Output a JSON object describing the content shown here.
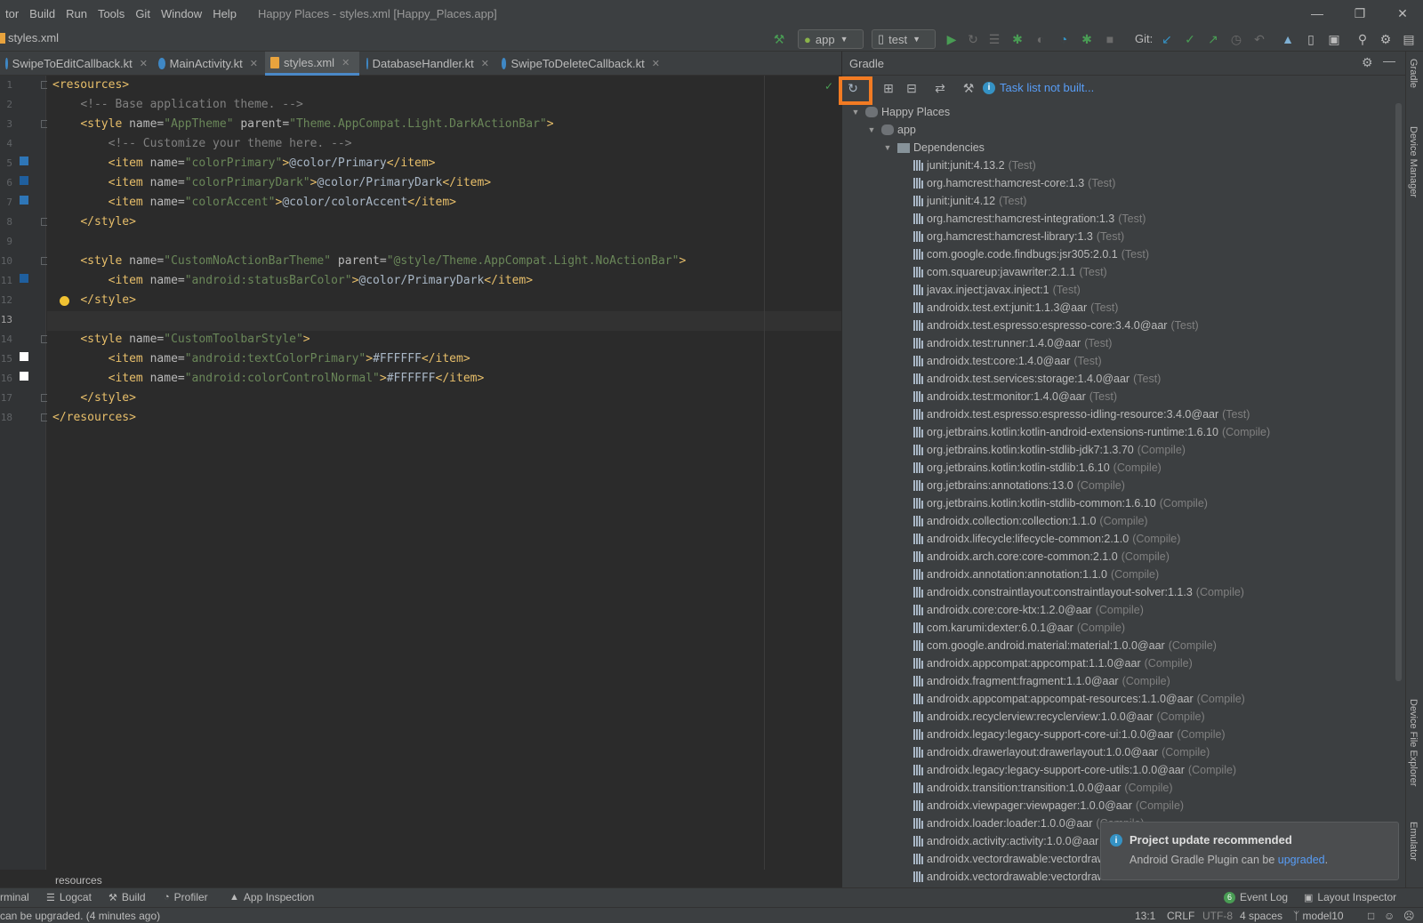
{
  "menubar": {
    "items": [
      "tor",
      "Build",
      "Run",
      "Tools",
      "Git",
      "Window",
      "Help"
    ],
    "window_title": "Happy Places - styles.xml [Happy_Places.app]"
  },
  "navbar": {
    "file": "styles.xml",
    "run_config": "app",
    "device": "test",
    "git_label": "Git:"
  },
  "tabs": [
    {
      "label": "SwipeToEditCallback.kt",
      "active": false
    },
    {
      "label": "MainActivity.kt",
      "active": false
    },
    {
      "label": "styles.xml",
      "active": true
    },
    {
      "label": "DatabaseHandler.kt",
      "active": false
    },
    {
      "label": "SwipeToDeleteCallback.kt",
      "active": false
    }
  ],
  "editor": {
    "line_numbers": [
      "1",
      "2",
      "3",
      "4",
      "5",
      "6",
      "7",
      "8",
      "9",
      "10",
      "11",
      "12",
      "13",
      "14",
      "15",
      "16",
      "17",
      "18"
    ],
    "swatch_colors": {
      "primary": "#2e76b7",
      "primary_dark": "#1f5f9e",
      "accent": "#2e76b7",
      "status_bar": "#1f5f9e",
      "white": "#FFFFFF"
    },
    "lines": {
      "l1_tag": "<resources>",
      "l2_comment": "<!-- Base application theme. -->",
      "l3_open": "<style ",
      "l3_attr1": "name=",
      "l3_val1": "\"AppTheme\"",
      "l3_attr2": " parent=",
      "l3_val2": "\"Theme.AppCompat.Light.DarkActionBar\"",
      "l3_close": ">",
      "l4_comment": "<!-- Customize your theme here. -->",
      "l5_open": "<item ",
      "l5_attr": "name=",
      "l5_val": "\"colorPrimary\"",
      "l5_gt": ">",
      "l5_text": "@color/Primary",
      "l5_close": "</item>",
      "l6_open": "<item ",
      "l6_attr": "name=",
      "l6_val": "\"colorPrimaryDark\"",
      "l6_gt": ">",
      "l6_text": "@color/PrimaryDark",
      "l6_close": "</item>",
      "l7_open": "<item ",
      "l7_attr": "name=",
      "l7_val": "\"colorAccent\"",
      "l7_gt": ">",
      "l7_text": "@color/colorAccent",
      "l7_close": "</item>",
      "l8_close": "</style>",
      "l10_open": "<style ",
      "l10_attr1": "name=",
      "l10_val1": "\"CustomNoActionBarTheme\"",
      "l10_attr2": " parent=",
      "l10_val2": "\"@style/Theme.AppCompat.Light.NoActionBar\"",
      "l10_gt": ">",
      "l11_open": "<item ",
      "l11_attr": "name=",
      "l11_val": "\"android:statusBarColor\"",
      "l11_gt": ">",
      "l11_text": "@color/PrimaryDark",
      "l11_close": "</item>",
      "l12_close": "</style>",
      "l14_open": "<style ",
      "l14_attr": "name=",
      "l14_val": "\"CustomToolbarStyle\"",
      "l14_gt": ">",
      "l15_open": "<item ",
      "l15_attr": "name=",
      "l15_val": "\"android:textColorPrimary\"",
      "l15_gt": ">",
      "l15_text": "#FFFFFF",
      "l15_close": "</item>",
      "l16_open": "<item ",
      "l16_attr": "name=",
      "l16_val": "\"android:colorControlNormal\"",
      "l16_gt": ">",
      "l16_text": "#FFFFFF",
      "l16_close": "</item>",
      "l17_close": "</style>",
      "l18_close": "</resources>"
    },
    "breadcrumb": "resources"
  },
  "gradle": {
    "title": "Gradle",
    "task_info": "Task list not built...",
    "root": "Happy Places",
    "module": "app",
    "dependencies_label": "Dependencies",
    "dependencies": [
      {
        "name": "junit:junit:4.13.2",
        "scope": "(Test)"
      },
      {
        "name": "org.hamcrest:hamcrest-core:1.3",
        "scope": "(Test)"
      },
      {
        "name": "junit:junit:4.12",
        "scope": "(Test)"
      },
      {
        "name": "org.hamcrest:hamcrest-integration:1.3",
        "scope": "(Test)"
      },
      {
        "name": "org.hamcrest:hamcrest-library:1.3",
        "scope": "(Test)"
      },
      {
        "name": "com.google.code.findbugs:jsr305:2.0.1",
        "scope": "(Test)"
      },
      {
        "name": "com.squareup:javawriter:2.1.1",
        "scope": "(Test)"
      },
      {
        "name": "javax.inject:javax.inject:1",
        "scope": "(Test)"
      },
      {
        "name": "androidx.test.ext:junit:1.1.3@aar",
        "scope": "(Test)"
      },
      {
        "name": "androidx.test.espresso:espresso-core:3.4.0@aar",
        "scope": "(Test)"
      },
      {
        "name": "androidx.test:runner:1.4.0@aar",
        "scope": "(Test)"
      },
      {
        "name": "androidx.test:core:1.4.0@aar",
        "scope": "(Test)"
      },
      {
        "name": "androidx.test.services:storage:1.4.0@aar",
        "scope": "(Test)"
      },
      {
        "name": "androidx.test:monitor:1.4.0@aar",
        "scope": "(Test)"
      },
      {
        "name": "androidx.test.espresso:espresso-idling-resource:3.4.0@aar",
        "scope": "(Test)"
      },
      {
        "name": "org.jetbrains.kotlin:kotlin-android-extensions-runtime:1.6.10",
        "scope": "(Compile)"
      },
      {
        "name": "org.jetbrains.kotlin:kotlin-stdlib-jdk7:1.3.70",
        "scope": "(Compile)"
      },
      {
        "name": "org.jetbrains.kotlin:kotlin-stdlib:1.6.10",
        "scope": "(Compile)"
      },
      {
        "name": "org.jetbrains:annotations:13.0",
        "scope": "(Compile)"
      },
      {
        "name": "org.jetbrains.kotlin:kotlin-stdlib-common:1.6.10",
        "scope": "(Compile)"
      },
      {
        "name": "androidx.collection:collection:1.1.0",
        "scope": "(Compile)"
      },
      {
        "name": "androidx.lifecycle:lifecycle-common:2.1.0",
        "scope": "(Compile)"
      },
      {
        "name": "androidx.arch.core:core-common:2.1.0",
        "scope": "(Compile)"
      },
      {
        "name": "androidx.annotation:annotation:1.1.0",
        "scope": "(Compile)"
      },
      {
        "name": "androidx.constraintlayout:constraintlayout-solver:1.1.3",
        "scope": "(Compile)"
      },
      {
        "name": "androidx.core:core-ktx:1.2.0@aar",
        "scope": "(Compile)"
      },
      {
        "name": "com.karumi:dexter:6.0.1@aar",
        "scope": "(Compile)"
      },
      {
        "name": "com.google.android.material:material:1.0.0@aar",
        "scope": "(Compile)"
      },
      {
        "name": "androidx.appcompat:appcompat:1.1.0@aar",
        "scope": "(Compile)"
      },
      {
        "name": "androidx.fragment:fragment:1.1.0@aar",
        "scope": "(Compile)"
      },
      {
        "name": "androidx.appcompat:appcompat-resources:1.1.0@aar",
        "scope": "(Compile)"
      },
      {
        "name": "androidx.recyclerview:recyclerview:1.0.0@aar",
        "scope": "(Compile)"
      },
      {
        "name": "androidx.legacy:legacy-support-core-ui:1.0.0@aar",
        "scope": "(Compile)"
      },
      {
        "name": "androidx.drawerlayout:drawerlayout:1.0.0@aar",
        "scope": "(Compile)"
      },
      {
        "name": "androidx.legacy:legacy-support-core-utils:1.0.0@aar",
        "scope": "(Compile)"
      },
      {
        "name": "androidx.transition:transition:1.0.0@aar",
        "scope": "(Compile)"
      },
      {
        "name": "androidx.viewpager:viewpager:1.0.0@aar",
        "scope": "(Compile)"
      },
      {
        "name": "androidx.loader:loader:1.0.0@aar",
        "scope": "(Compile)"
      },
      {
        "name": "androidx.activity:activity:1.0.0@aar",
        "scope": ""
      },
      {
        "name": "androidx.vectordrawable:vectordraw",
        "scope": ""
      },
      {
        "name": "androidx.vectordrawable:vectordraw",
        "scope": ""
      }
    ]
  },
  "notification": {
    "title": "Project update recommended",
    "body_prefix": "Android Gradle Plugin can be ",
    "link": "upgraded",
    "body_suffix": "."
  },
  "right_strip": {
    "gradle": "Gradle",
    "device_manager": "Device Manager",
    "device_file_explorer": "Device File Explorer",
    "emulator": "Emulator"
  },
  "toolwindows": {
    "terminal": "rminal",
    "logcat": "Logcat",
    "build": "Build",
    "profiler": "Profiler",
    "app_inspection": "App Inspection",
    "event_log_count": "6",
    "event_log": "Event Log",
    "layout_inspector": "Layout Inspector"
  },
  "statusbar": {
    "message": "can be upgraded. (4 minutes ago)",
    "position": "13:1",
    "line_sep": "CRLF",
    "encoding": "UTF-8",
    "indent": "4 spaces",
    "branch": "model10"
  },
  "colors": {
    "accent_highlight": "#f27b23",
    "link": "#589df6",
    "run_green": "#499c54"
  }
}
